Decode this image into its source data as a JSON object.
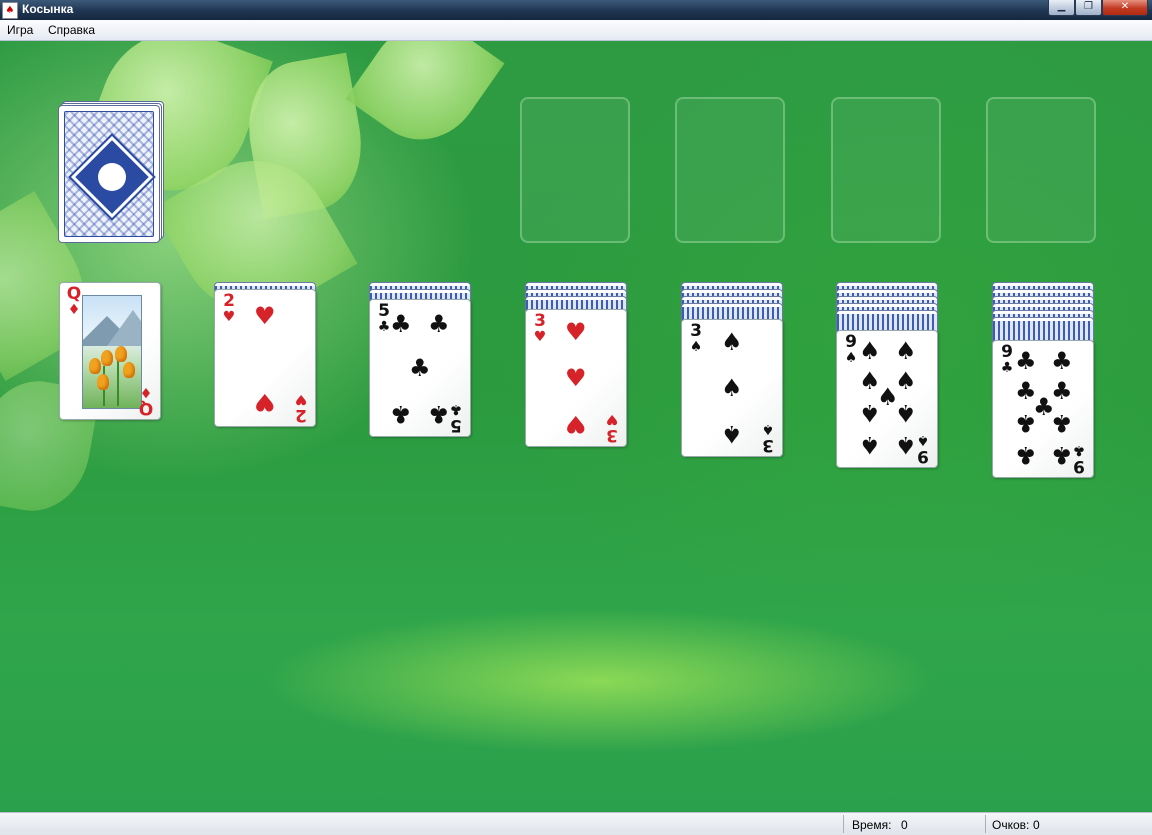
{
  "window": {
    "title": "Косынка",
    "app_icon": "solitaire-card-icon",
    "controls": {
      "minimize": "▁",
      "maximize": "❐",
      "close": "✕"
    }
  },
  "menu": {
    "items": [
      "Игра",
      "Справка"
    ]
  },
  "foundations": {
    "count": 4
  },
  "stock": {
    "cards": "face-down"
  },
  "tableau": [
    {
      "face_down": 0,
      "face_up": {
        "rank": "Q",
        "suit": "♦",
        "color": "red"
      }
    },
    {
      "face_down": 1,
      "face_up": {
        "rank": "2",
        "suit": "♥",
        "color": "red"
      }
    },
    {
      "face_down": 2,
      "face_up": {
        "rank": "5",
        "suit": "♣",
        "color": "black"
      }
    },
    {
      "face_down": 3,
      "face_up": {
        "rank": "3",
        "suit": "♥",
        "color": "red"
      }
    },
    {
      "face_down": 4,
      "face_up": {
        "rank": "3",
        "suit": "♠",
        "color": "black"
      }
    },
    {
      "face_down": 5,
      "face_up": {
        "rank": "9",
        "suit": "♠",
        "color": "black"
      }
    },
    {
      "face_down": 6,
      "face_up": {
        "rank": "9",
        "suit": "♣",
        "color": "black"
      }
    }
  ],
  "status": {
    "time_label": "Время:",
    "time_value": "0",
    "score_label": "Очков:",
    "score_value": "0"
  },
  "colors": {
    "felt": "#2e9b43",
    "red_suit": "#d6232a",
    "card_back": "#2b4ba3"
  }
}
